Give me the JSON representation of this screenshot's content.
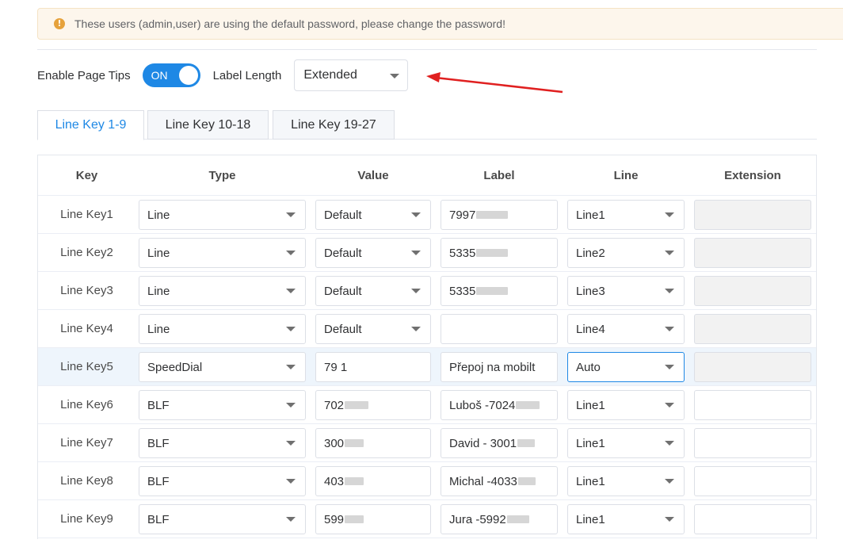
{
  "alert": {
    "icon": "exclamation-icon",
    "text": "These users (admin,user) are using the default password, please change the password!"
  },
  "options": {
    "page_tips_label": "Enable Page Tips",
    "page_tips_toggle": "ON",
    "label_length_label": "Label Length",
    "label_length_value": "Extended"
  },
  "tabs": [
    "Line Key 1-9",
    "Line Key 10-18",
    "Line Key 19-27"
  ],
  "table": {
    "headers": [
      "Key",
      "Type",
      "Value",
      "Label",
      "Line",
      "Extension"
    ],
    "rows": [
      {
        "key": "Line Key1",
        "type": "Line",
        "value": "Default",
        "label": "7997",
        "line": "Line1",
        "extension": ""
      },
      {
        "key": "Line Key2",
        "type": "Line",
        "value": "Default",
        "label": "5335",
        "line": "Line2",
        "extension": ""
      },
      {
        "key": "Line Key3",
        "type": "Line",
        "value": "Default",
        "label": "5335",
        "line": "Line3",
        "extension": ""
      },
      {
        "key": "Line Key4",
        "type": "Line",
        "value": "Default",
        "label": "",
        "line": "Line4",
        "extension": ""
      },
      {
        "key": "Line Key5",
        "type": "SpeedDial",
        "value": "79 1",
        "label": "Přepoj na mobilt",
        "line": "Auto",
        "extension": ""
      },
      {
        "key": "Line Key6",
        "type": "BLF",
        "value": "702",
        "label": "Luboš -7024",
        "line": "Line1",
        "extension": ""
      },
      {
        "key": "Line Key7",
        "type": "BLF",
        "value": "300",
        "label": "David - 3001",
        "line": "Line1",
        "extension": ""
      },
      {
        "key": "Line Key8",
        "type": "BLF",
        "value": "403",
        "label": "Michal -4033",
        "line": "Line1",
        "extension": ""
      },
      {
        "key": "Line Key9",
        "type": "BLF",
        "value": "599",
        "label": "Jura -5992",
        "line": "Line1",
        "extension": ""
      }
    ]
  },
  "colors": {
    "accent": "#1e88e5",
    "warning": "#e6a23c",
    "annotation_arrow": "#e02020"
  }
}
